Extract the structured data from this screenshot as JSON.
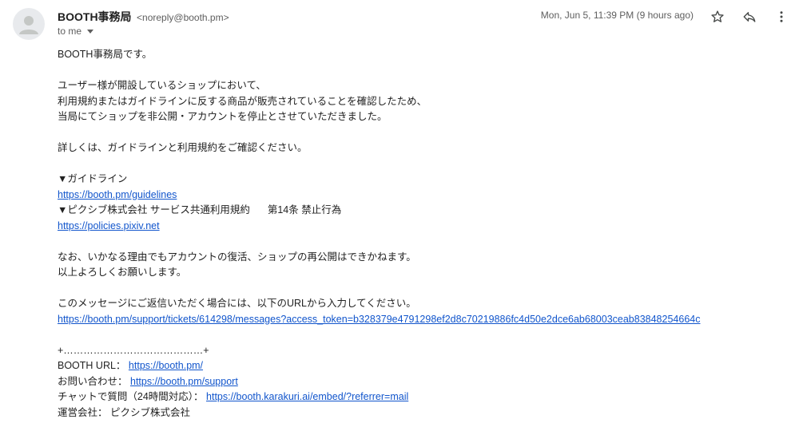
{
  "header": {
    "sender_name": "BOOTH事務局",
    "sender_email": "<noreply@booth.pm>",
    "to_label": "to me",
    "date": "Mon, Jun 5, 11:39 PM (9 hours ago)"
  },
  "icons": {
    "avatar": "person-avatar-icon",
    "star": "star-icon",
    "reply": "reply-icon",
    "more": "more-vert-icon",
    "dropdown": "chevron-down-icon"
  },
  "colors": {
    "link": "#1155cc",
    "text": "#222222",
    "meta": "#5e5e5e"
  },
  "body": {
    "greeting": "BOOTH事務局です。",
    "p1_l1": "ユーザー様が開設しているショップにおいて、",
    "p1_l2": "利用規約またはガイドラインに反する商品が販売されていることを確認したため、",
    "p1_l3": "当局にてショップを非公開・アカウントを停止とさせていただきました。",
    "p2": "詳しくは、ガイドラインと利用規約をご確認ください。",
    "guideline_heading": "▼ガイドライン",
    "guideline_link": "https://booth.pm/guidelines",
    "terms_heading_a": "▼ピクシブ株式会社 サービス共通利用規約",
    "terms_heading_b": "第14条 禁止行為",
    "terms_link": "https://policies.pixiv.net",
    "p3_l1": "なお、いかなる理由でもアカウントの復活、ショップの再公開はできかねます。",
    "p3_l2": "以上よろしくお願いします。",
    "p4": "このメッセージにご返信いただく場合には、以下のURLから入力してください。",
    "ticket_link": "https://booth.pm/support/tickets/614298/messages?access_token=b328379e4791298ef2d8c70219886fc4d50e2dce6ab68003ceab83848254664c",
    "divider": "+……………………………………+",
    "booth_url_label": "BOOTH URL：",
    "booth_url_link": "https://booth.pm/",
    "contact_label": "お問い合わせ：",
    "contact_link": "https://booth.pm/support",
    "chat_label": "チャットで質問（24時間対応）：",
    "chat_link": "https://booth.karakuri.ai/embed/?referrer=mail",
    "company_label": "運営会社：",
    "company_value": "ピクシブ株式会社"
  }
}
